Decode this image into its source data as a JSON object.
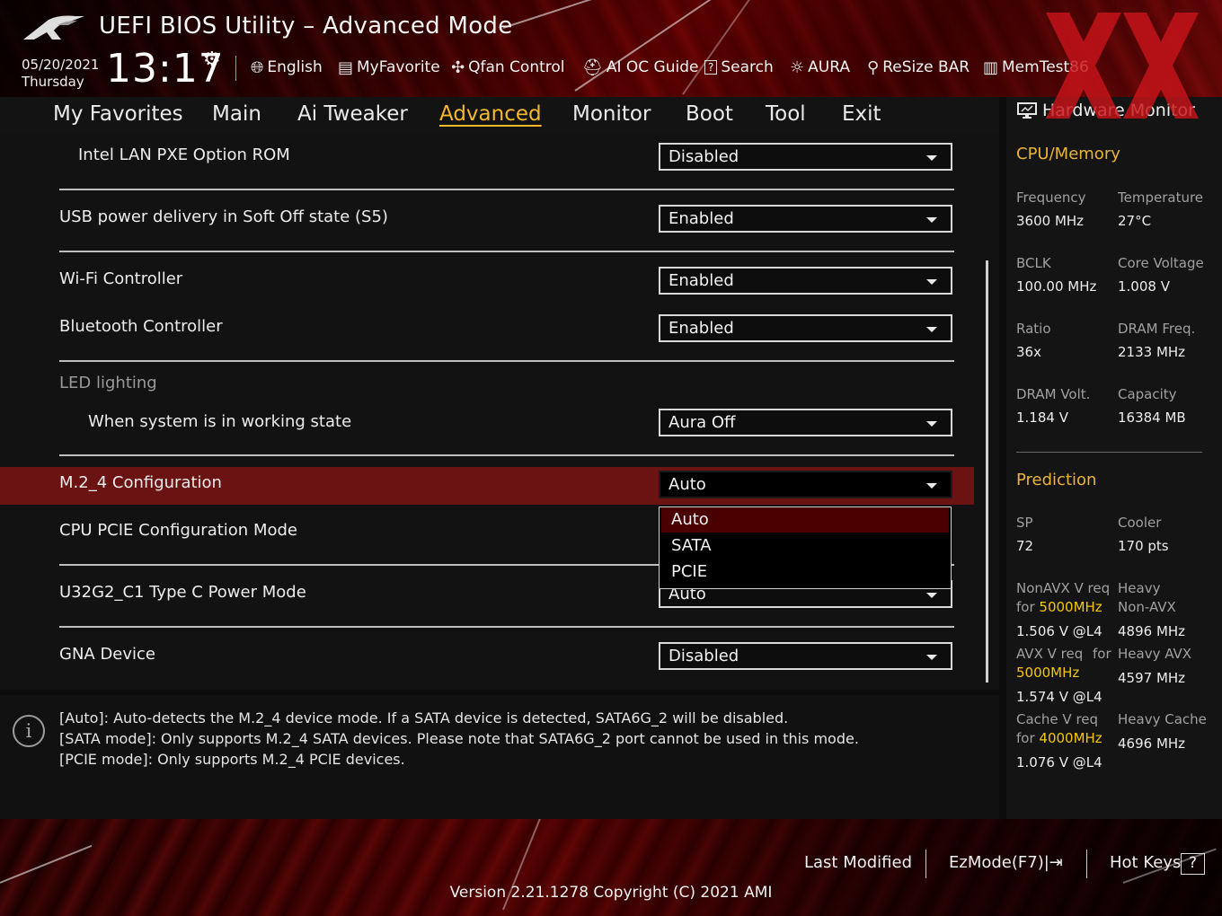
{
  "header": {
    "title": "UEFI BIOS Utility – Advanced Mode",
    "date": "05/20/2021",
    "day": "Thursday",
    "time": "13:17",
    "toolbar": [
      {
        "label": "English",
        "icon": "globe-icon"
      },
      {
        "label": "MyFavorite",
        "icon": "favorite-icon"
      },
      {
        "label": "Qfan Control",
        "icon": "fan-icon"
      },
      {
        "label": "AI OC Guide",
        "icon": "ai-oc-icon"
      },
      {
        "label": "Search",
        "icon": "search-icon"
      },
      {
        "label": "AURA",
        "icon": "aura-icon"
      },
      {
        "label": "ReSize BAR",
        "icon": "resize-bar-icon"
      },
      {
        "label": "MemTest86",
        "icon": "memtest-icon"
      }
    ]
  },
  "menu": {
    "tabs": [
      "My Favorites",
      "Main",
      "Ai Tweaker",
      "Advanced",
      "Monitor",
      "Boot",
      "Tool",
      "Exit"
    ],
    "active": "Advanced"
  },
  "settings": {
    "intel_lan_pxe": {
      "label": "Intel LAN PXE Option ROM",
      "value": "Disabled"
    },
    "usb_power_s5": {
      "label": "USB power delivery in Soft Off state (S5)",
      "value": "Enabled"
    },
    "wifi": {
      "label": "Wi-Fi Controller",
      "value": "Enabled"
    },
    "bluetooth": {
      "label": "Bluetooth Controller",
      "value": "Enabled"
    },
    "led_header": "LED lighting",
    "led_working": {
      "label": "When system is in working state",
      "value": "Aura Off"
    },
    "m2_4": {
      "label": "M.2_4 Configuration",
      "value": "Auto",
      "options": [
        "Auto",
        "SATA",
        "PCIE"
      ]
    },
    "cpu_pcie": {
      "label": "CPU PCIE Configuration Mode"
    },
    "u32g2": {
      "label": "U32G2_C1 Type C Power Mode",
      "value": "Auto"
    },
    "gna": {
      "label": "GNA Device",
      "value": "Disabled"
    }
  },
  "help": {
    "icon": "info-icon",
    "lines": [
      "[Auto]: Auto-detects the M.2_4 device mode. If a SATA device is detected, SATA6G_2 will be disabled.",
      "[SATA mode]: Only supports M.2_4 SATA devices. Please note that SATA6G_2 port cannot be used in this mode.",
      "[PCIE mode]: Only supports M.2_4 PCIE devices."
    ]
  },
  "hw_monitor": {
    "title": "Hardware Monitor",
    "cpu_memory": {
      "heading": "CPU/Memory",
      "frequency": {
        "label": "Frequency",
        "value": "3600 MHz"
      },
      "temperature": {
        "label": "Temperature",
        "value": "27°C"
      },
      "bclk": {
        "label": "BCLK",
        "value": "100.00 MHz"
      },
      "core_voltage": {
        "label": "Core Voltage",
        "value": "1.008 V"
      },
      "ratio": {
        "label": "Ratio",
        "value": "36x"
      },
      "dram_freq": {
        "label": "DRAM Freq.",
        "value": "2133 MHz"
      },
      "dram_volt": {
        "label": "DRAM Volt.",
        "value": "1.184 V"
      },
      "capacity": {
        "label": "Capacity",
        "value": "16384 MB"
      }
    },
    "prediction": {
      "heading": "Prediction",
      "sp": {
        "label": "SP",
        "value": "72"
      },
      "cooler": {
        "label": "Cooler",
        "value": "170 pts"
      },
      "nonavx_req": {
        "label1": "NonAVX V req",
        "label2_prefix": "for ",
        "label2_freq": "5000MHz",
        "value": "1.506 V @L4"
      },
      "heavy_nonavx": {
        "label1": "Heavy",
        "label2": "Non-AVX",
        "value": "4896 MHz"
      },
      "avx_req": {
        "label1": "AVX V req",
        "label1_for": "for",
        "label2_freq": "5000MHz",
        "value": "1.574 V @L4"
      },
      "heavy_avx": {
        "label": "Heavy AVX",
        "value": "4597 MHz"
      },
      "cache_req": {
        "label1": "Cache V req",
        "label2_prefix": "for ",
        "label2_freq": "4000MHz",
        "value": "1.076 V @L4"
      },
      "heavy_cache": {
        "label": "Heavy Cache",
        "value": "4696 MHz"
      }
    }
  },
  "footer": {
    "last_modified": "Last Modified",
    "ezmode": "EzMode(F7)|",
    "hotkeys": "Hot Keys",
    "hotkeys_symbol": "?",
    "version": "Version 2.21.1278 Copyright (C) 2021 AMI"
  },
  "colors": {
    "accent": "#f5b82a",
    "highlight_row": "#6b1212",
    "hw_heading": "#e9b33a",
    "freq_highlight": "#f3c800"
  }
}
